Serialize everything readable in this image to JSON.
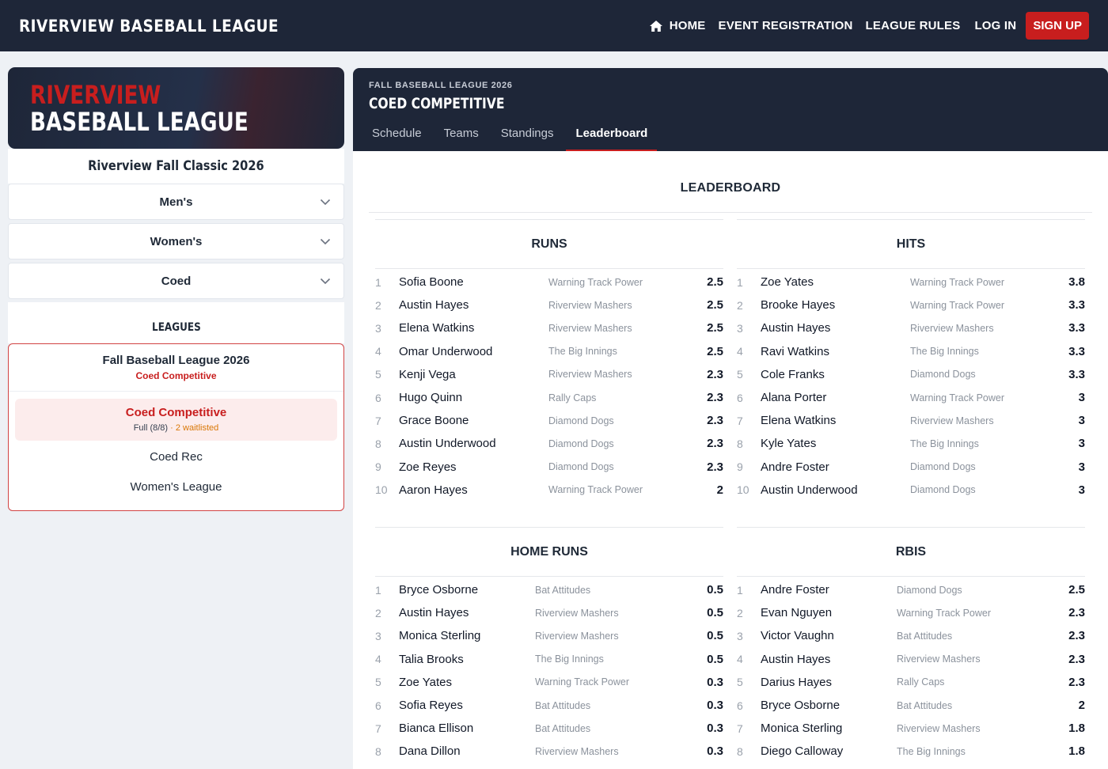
{
  "nav": {
    "brand": "RIVERVIEW BASEBALL LEAGUE",
    "home_icon": "home-icon",
    "links": [
      "HOME",
      "EVENT REGISTRATION",
      "LEAGUE RULES",
      "LOG IN"
    ],
    "signup": "SIGN UP",
    "accent_color": "#c81e1e",
    "bg_color": "#1e2638"
  },
  "sidebar": {
    "hero_line1": "RIVERVIEW",
    "hero_line2": "BASEBALL LEAGUE",
    "event_title": "Riverview Fall Classic 2026",
    "accordions": [
      "Men's",
      "Women's",
      "Coed"
    ],
    "leagues_heading": "LEAGUES",
    "league_box": {
      "title": "Fall Baseball League 2026",
      "subtitle": "Coed Competitive",
      "active_name": "Coed Competitive",
      "active_meta_full": "Full (8/8)",
      "active_meta_sep": " · ",
      "active_meta_wait": "2 waitlisted",
      "items": [
        "Coed Rec",
        "Women's League"
      ]
    }
  },
  "main": {
    "kicker": "FALL BASEBALL LEAGUE 2026",
    "title": "COED COMPETITIVE",
    "tabs": [
      "Schedule",
      "Teams",
      "Standings",
      "Leaderboard"
    ],
    "active_tab": "Leaderboard",
    "leaderboard_title": "LEADERBOARD",
    "categories": [
      {
        "title": "RUNS",
        "rows": [
          {
            "rank": "1",
            "name": "Sofia Boone",
            "team": "Warning Track Power",
            "value": "2.5"
          },
          {
            "rank": "2",
            "name": "Austin Hayes",
            "team": "Riverview Mashers",
            "value": "2.5"
          },
          {
            "rank": "3",
            "name": "Elena Watkins",
            "team": "Riverview Mashers",
            "value": "2.5"
          },
          {
            "rank": "4",
            "name": "Omar Underwood",
            "team": "The Big Innings",
            "value": "2.5"
          },
          {
            "rank": "5",
            "name": "Kenji Vega",
            "team": "Riverview Mashers",
            "value": "2.3"
          },
          {
            "rank": "6",
            "name": "Hugo Quinn",
            "team": "Rally Caps",
            "value": "2.3"
          },
          {
            "rank": "7",
            "name": "Grace Boone",
            "team": "Diamond Dogs",
            "value": "2.3"
          },
          {
            "rank": "8",
            "name": "Austin Underwood",
            "team": "Diamond Dogs",
            "value": "2.3"
          },
          {
            "rank": "9",
            "name": "Zoe Reyes",
            "team": "Diamond Dogs",
            "value": "2.3"
          },
          {
            "rank": "10",
            "name": "Aaron Hayes",
            "team": "Warning Track Power",
            "value": "2"
          }
        ]
      },
      {
        "title": "HITS",
        "rows": [
          {
            "rank": "1",
            "name": "Zoe Yates",
            "team": "Warning Track Power",
            "value": "3.8"
          },
          {
            "rank": "2",
            "name": "Brooke Hayes",
            "team": "Warning Track Power",
            "value": "3.3"
          },
          {
            "rank": "3",
            "name": "Austin Hayes",
            "team": "Riverview Mashers",
            "value": "3.3"
          },
          {
            "rank": "4",
            "name": "Ravi Watkins",
            "team": "The Big Innings",
            "value": "3.3"
          },
          {
            "rank": "5",
            "name": "Cole Franks",
            "team": "Diamond Dogs",
            "value": "3.3"
          },
          {
            "rank": "6",
            "name": "Alana Porter",
            "team": "Warning Track Power",
            "value": "3"
          },
          {
            "rank": "7",
            "name": "Elena Watkins",
            "team": "Riverview Mashers",
            "value": "3"
          },
          {
            "rank": "8",
            "name": "Kyle Yates",
            "team": "The Big Innings",
            "value": "3"
          },
          {
            "rank": "9",
            "name": "Andre Foster",
            "team": "Diamond Dogs",
            "value": "3"
          },
          {
            "rank": "10",
            "name": "Austin Underwood",
            "team": "Diamond Dogs",
            "value": "3"
          }
        ]
      },
      {
        "title": "HOME RUNS",
        "rows": [
          {
            "rank": "1",
            "name": "Bryce Osborne",
            "team": "Bat Attitudes",
            "value": "0.5"
          },
          {
            "rank": "2",
            "name": "Austin Hayes",
            "team": "Riverview Mashers",
            "value": "0.5"
          },
          {
            "rank": "3",
            "name": "Monica Sterling",
            "team": "Riverview Mashers",
            "value": "0.5"
          },
          {
            "rank": "4",
            "name": "Talia Brooks",
            "team": "The Big Innings",
            "value": "0.5"
          },
          {
            "rank": "5",
            "name": "Zoe Yates",
            "team": "Warning Track Power",
            "value": "0.3"
          },
          {
            "rank": "6",
            "name": "Sofia Reyes",
            "team": "Bat Attitudes",
            "value": "0.3"
          },
          {
            "rank": "7",
            "name": "Bianca Ellison",
            "team": "Bat Attitudes",
            "value": "0.3"
          },
          {
            "rank": "8",
            "name": "Dana Dillon",
            "team": "Riverview Mashers",
            "value": "0.3"
          }
        ]
      },
      {
        "title": "RBIS",
        "rows": [
          {
            "rank": "1",
            "name": "Andre Foster",
            "team": "Diamond Dogs",
            "value": "2.5"
          },
          {
            "rank": "2",
            "name": "Evan Nguyen",
            "team": "Warning Track Power",
            "value": "2.3"
          },
          {
            "rank": "3",
            "name": "Victor Vaughn",
            "team": "Bat Attitudes",
            "value": "2.3"
          },
          {
            "rank": "4",
            "name": "Austin Hayes",
            "team": "Riverview Mashers",
            "value": "2.3"
          },
          {
            "rank": "5",
            "name": "Darius Hayes",
            "team": "Rally Caps",
            "value": "2.3"
          },
          {
            "rank": "6",
            "name": "Bryce Osborne",
            "team": "Bat Attitudes",
            "value": "2"
          },
          {
            "rank": "7",
            "name": "Monica Sterling",
            "team": "Riverview Mashers",
            "value": "1.8"
          },
          {
            "rank": "8",
            "name": "Diego Calloway",
            "team": "The Big Innings",
            "value": "1.8"
          }
        ]
      }
    ]
  }
}
